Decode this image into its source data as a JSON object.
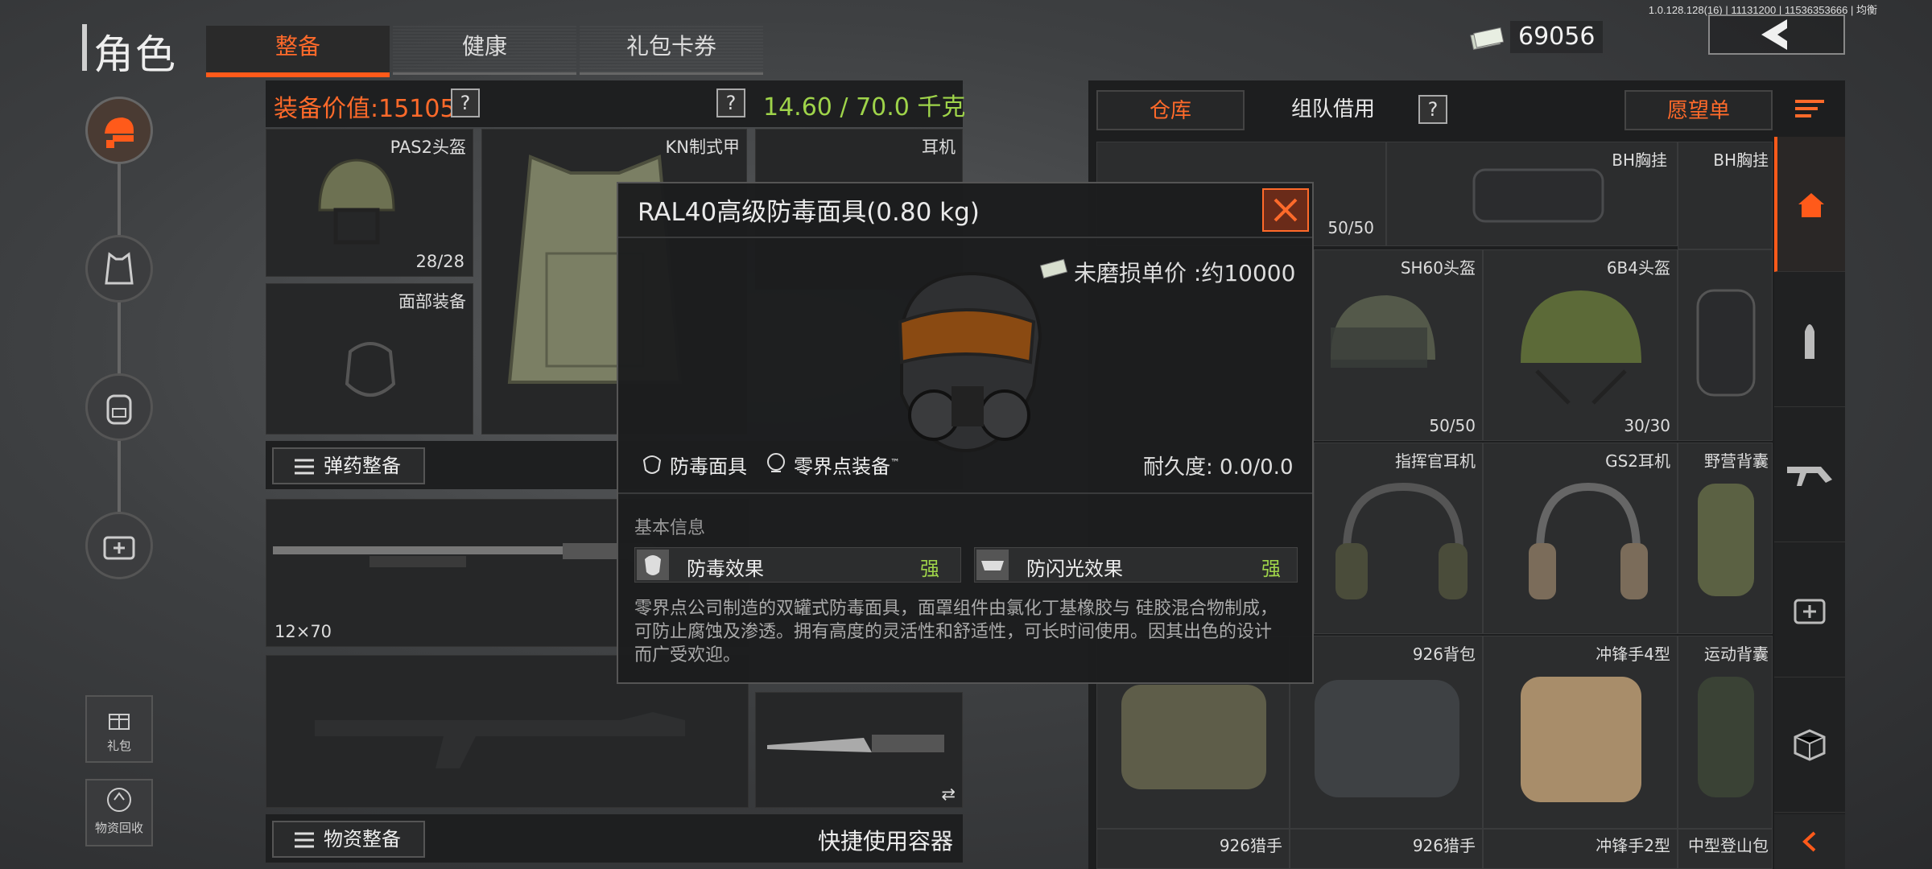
{
  "version": "1.0.128.128(16) | 11131200 | 11536353666 | 均衡",
  "header": {
    "title": "角色",
    "tabs": [
      {
        "label": "整备",
        "active": true
      },
      {
        "label": "健康",
        "active": false
      },
      {
        "label": "礼包卡券",
        "active": false
      }
    ],
    "currency": "69056"
  },
  "left_rail": {
    "bottom": [
      {
        "label": "礼包",
        "icon": "gift-icon"
      },
      {
        "label": "物资回收",
        "icon": "recycle-icon"
      }
    ]
  },
  "equipment": {
    "value_label": "装备价值:15105",
    "help": "?",
    "weight": "14.60 / 70.0 千克",
    "slots": {
      "helmet": {
        "label": "PAS2头盔",
        "durability": "28/28"
      },
      "armor": {
        "label": "KN制式甲"
      },
      "headset": {
        "label": "耳机"
      },
      "face": {
        "label": "面部装备"
      }
    },
    "ammo_button": "弹药整备",
    "weapon_primary_ammo": "12×70",
    "supply_button": "物资整备",
    "quick_container": "快捷使用容器"
  },
  "warehouse": {
    "tabs": [
      {
        "label": "仓库",
        "style": "orange"
      },
      {
        "label": "组队借用",
        "style": "normal"
      },
      {
        "label": "愿望单",
        "style": "orange"
      }
    ],
    "items": [
      {
        "label": "",
        "count": "50/50"
      },
      {
        "label": "BH胸挂",
        "count": ""
      },
      {
        "label": "BH胸挂",
        "count": ""
      },
      {
        "label": "SH60头盔",
        "count": "50/50"
      },
      {
        "label": "6B4头盔",
        "count": "30/30"
      },
      {
        "label": "指挥官耳机",
        "count": ""
      },
      {
        "label": "GS2耳机",
        "count": ""
      },
      {
        "label": "野营背囊",
        "count": ""
      },
      {
        "label": "926背包",
        "count": ""
      },
      {
        "label": "冲锋手4型",
        "count": ""
      },
      {
        "label": "运动背囊",
        "count": ""
      },
      {
        "label": "926猎手",
        "count": ""
      },
      {
        "label": "926猎手",
        "count": ""
      },
      {
        "label": "冲锋手2型",
        "count": ""
      },
      {
        "label": "中型登山包",
        "count": ""
      }
    ]
  },
  "modal": {
    "title": "RAL40高级防毒面具(0.80 kg)",
    "price": "未磨损单价 :约10000",
    "tag_type": "防毒面具",
    "tag_brand": "零界点装备",
    "tag_brand_mark": "™",
    "durability": "耐久度: 0.0/0.0",
    "section": "基本信息",
    "effects": [
      {
        "name": "防毒效果",
        "value": "强"
      },
      {
        "name": "防闪光效果",
        "value": "强"
      }
    ],
    "description": "零界点公司制造的双罐式防毒面具，面罩组件由氯化丁基橡胶与 硅胶混合物制成，可防止腐蚀及渗透。拥有高度的灵活性和舒适性，可长时间使用。因其出色的设计而广受欢迎。"
  },
  "colors": {
    "accent": "#ff5a1a",
    "good": "#9fd44a"
  }
}
